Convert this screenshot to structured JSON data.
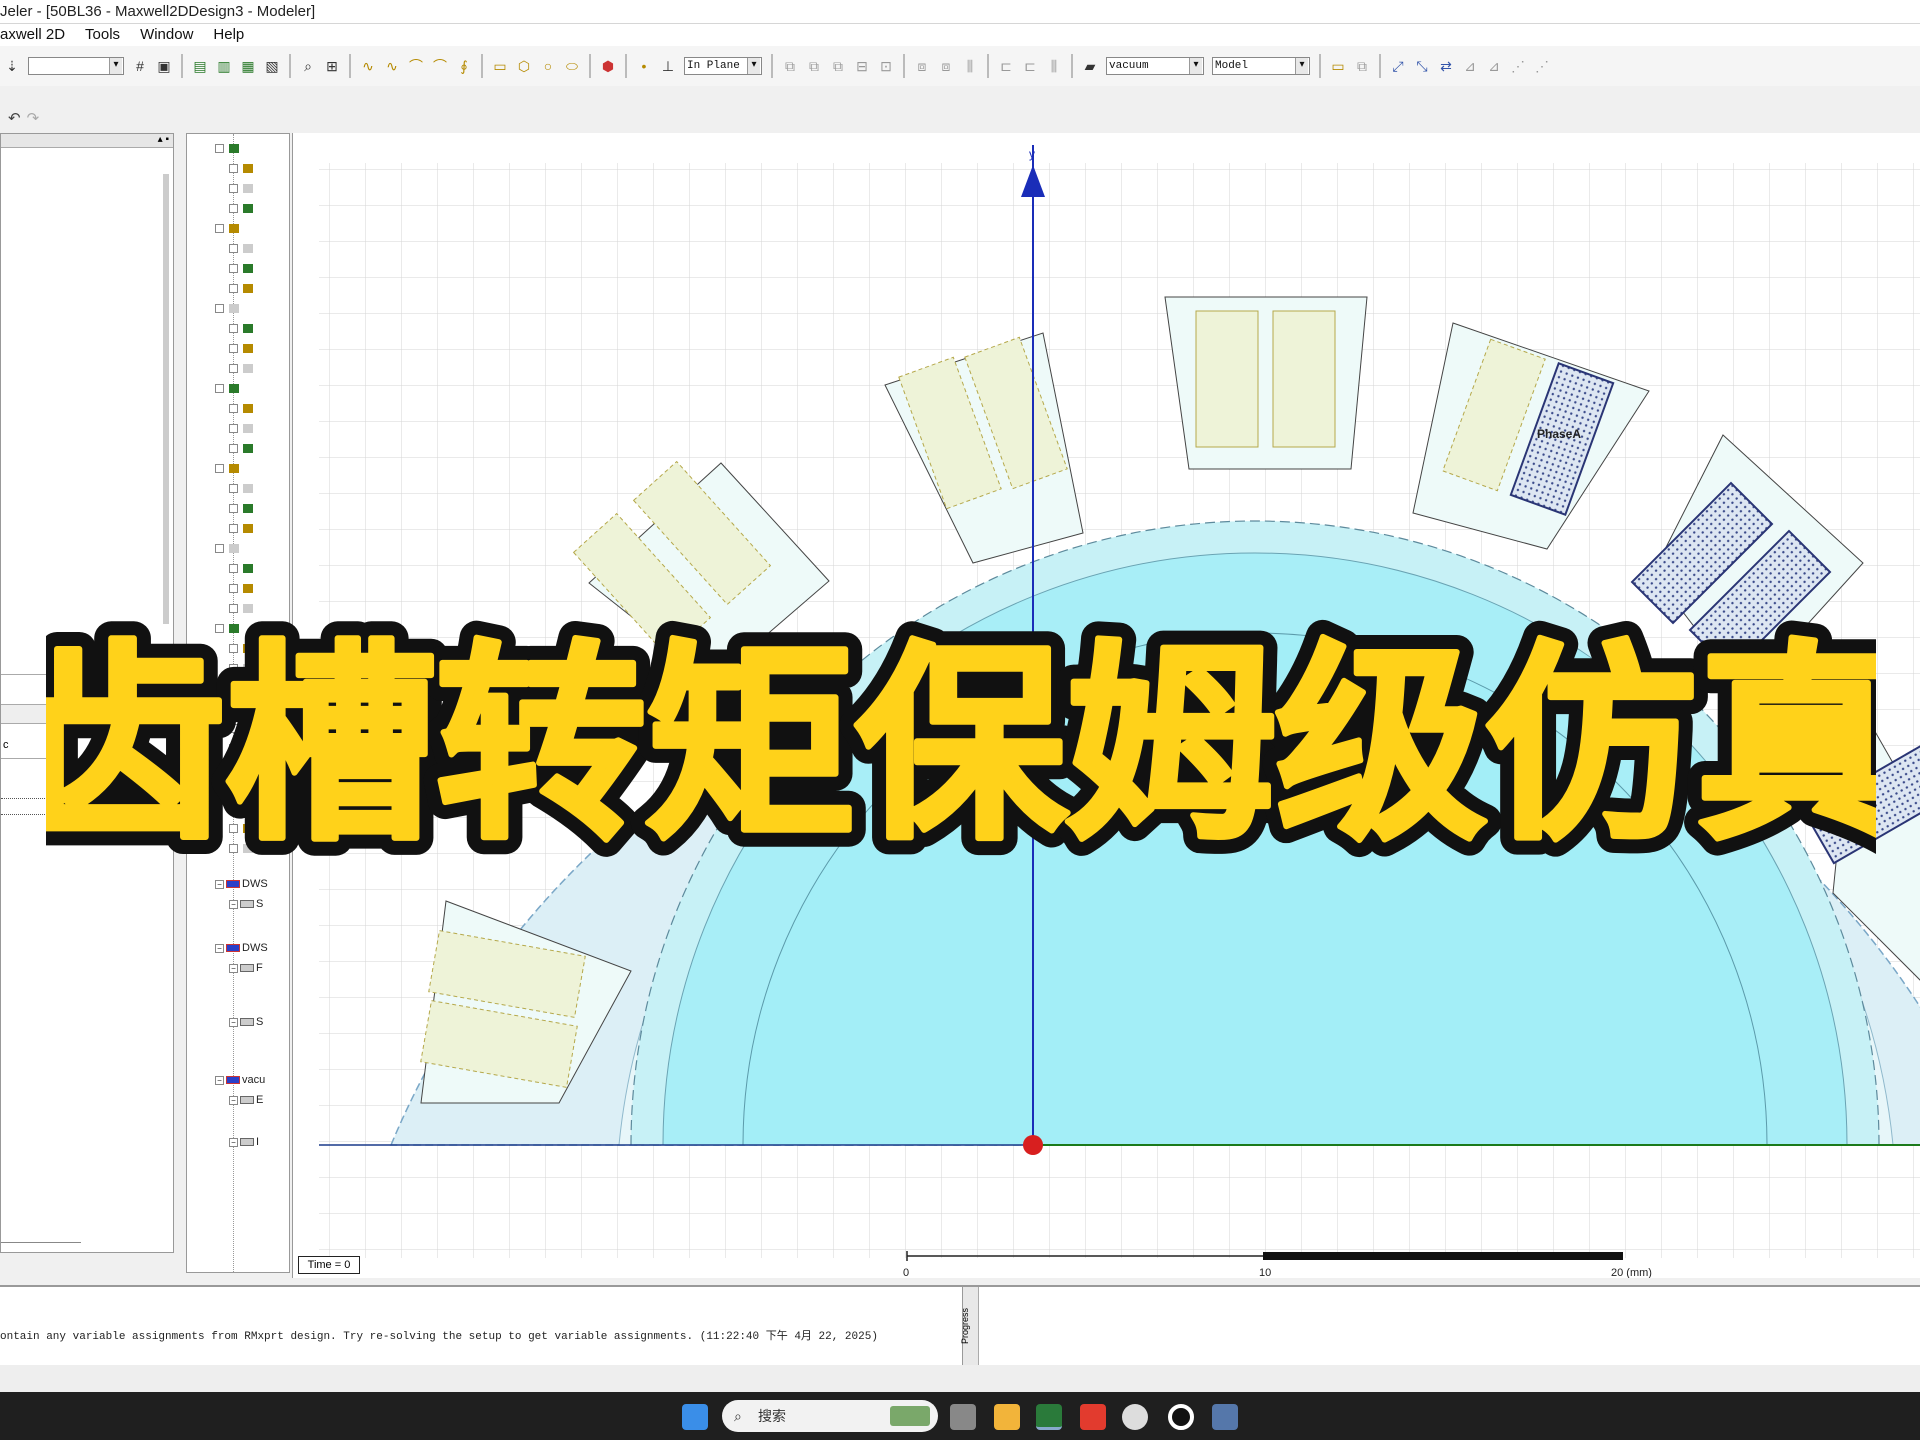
{
  "window": {
    "title": "Jeler - [50BL36 - Maxwell2DDesign3 - Modeler]"
  },
  "menu": [
    "axwell 2D",
    "Tools",
    "Window",
    "Help"
  ],
  "toolbar": {
    "select_blank": "",
    "plane_select": "In Plane",
    "material_select": "vacuum",
    "model_select": "Model"
  },
  "left_panel": {
    "status_label": "c"
  },
  "tree": {
    "items": [
      {
        "label": "DWS",
        "kind": "solid-blue"
      },
      {
        "label": "S",
        "kind": "box"
      },
      {
        "label": "DWS",
        "kind": "solid-blue"
      },
      {
        "label": "F",
        "kind": "box"
      },
      {
        "label": "S",
        "kind": "box"
      },
      {
        "label": "vacu",
        "kind": "solid-blue"
      },
      {
        "label": "E",
        "kind": "box"
      },
      {
        "label": "I",
        "kind": "box"
      }
    ]
  },
  "canvas": {
    "axis_label_y": "y",
    "coil_label": "PhaseA",
    "time_badge": "Time = 0",
    "scale_ticks": [
      "0",
      "10",
      "20 (mm)"
    ]
  },
  "messages": {
    "line1": "ontain any variable assignments from RMxprt design.  Try re-solving the setup to get variable assignments. (11:22:40 下午  4月 22, 2025)"
  },
  "progress": {
    "label": "Progress"
  },
  "taskbar": {
    "search_placeholder": "搜索"
  },
  "overlay": {
    "headline": "齿槽转矩保姆级仿真"
  },
  "colors": {
    "headline_fill": "#FFD21A",
    "headline_stroke": "#111111",
    "stator": "#DCEFF6",
    "rotor": "#A8EEF7",
    "axis": "#1A2DB8"
  }
}
